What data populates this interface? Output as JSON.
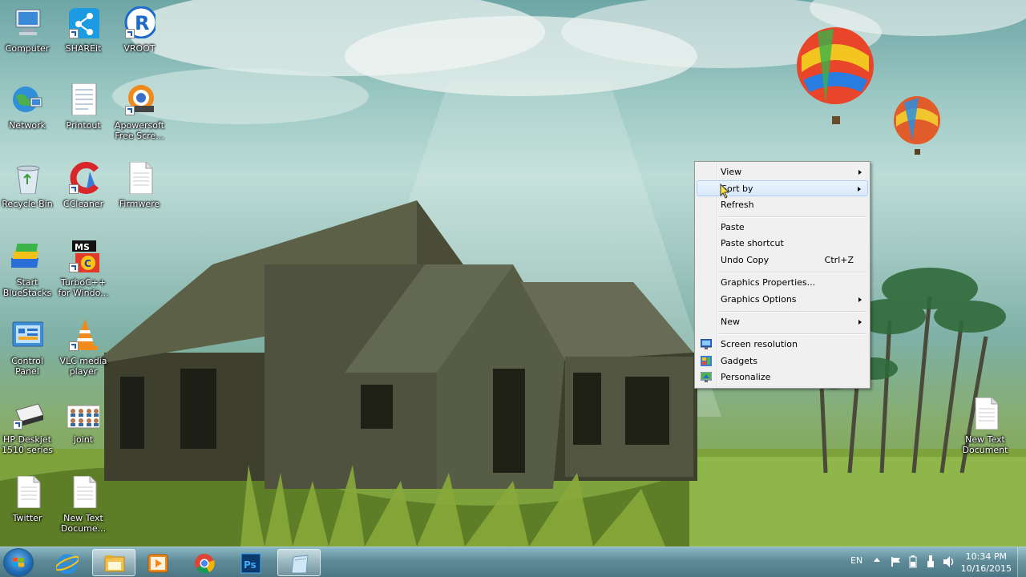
{
  "desktop_icons": [
    {
      "id": "computer",
      "label": "Computer"
    },
    {
      "id": "shareit",
      "label": "SHAREit"
    },
    {
      "id": "vroot",
      "label": "VROOT"
    },
    {
      "id": "network",
      "label": "Network"
    },
    {
      "id": "printout",
      "label": "Printout"
    },
    {
      "id": "apowersoft",
      "label": "Apowersoft\nFree Scre..."
    },
    {
      "id": "recycle-bin",
      "label": "Recycle Bin"
    },
    {
      "id": "ccleaner",
      "label": "CCleaner"
    },
    {
      "id": "firmwere",
      "label": "Firmwere"
    },
    {
      "id": "bluestacks",
      "label": "Start\nBlueStacks"
    },
    {
      "id": "turboc",
      "label": "TurboC++\nfor Windo..."
    },
    {
      "id": "control-panel",
      "label": "Control\nPanel"
    },
    {
      "id": "vlc",
      "label": "VLC media\nplayer"
    },
    {
      "id": "hp-deskjet",
      "label": "HP Deskjet\n1510 series"
    },
    {
      "id": "joint",
      "label": "joint"
    },
    {
      "id": "twitter",
      "label": "Twitter"
    },
    {
      "id": "new-text-document-left",
      "label": "New Text\nDocume..."
    },
    {
      "id": "new-text-document-right",
      "label": "New Text\nDocument"
    }
  ],
  "context_menu": {
    "items": [
      {
        "label": "View",
        "submenu": true
      },
      {
        "label": "Sort by",
        "submenu": true,
        "highlighted": true
      },
      {
        "label": "Refresh"
      },
      {
        "label": "Paste"
      },
      {
        "label": "Paste shortcut"
      },
      {
        "label": "Undo Copy",
        "shortcut": "Ctrl+Z"
      },
      {
        "label": "Graphics Properties..."
      },
      {
        "label": "Graphics Options",
        "submenu": true
      },
      {
        "label": "New",
        "submenu": true
      },
      {
        "label": "Screen resolution",
        "icon": "screen-resolution-icon"
      },
      {
        "label": "Gadgets",
        "icon": "gadgets-icon"
      },
      {
        "label": "Personalize",
        "icon": "personalize-icon"
      }
    ]
  },
  "taskbar": {
    "pinned": [
      "internet-explorer",
      "windows-explorer",
      "media-player",
      "google-chrome",
      "photoshop",
      "notepad"
    ],
    "tray": {
      "language": "EN",
      "time": "10:34 PM",
      "date": "10/16/2015"
    }
  },
  "colors": {
    "menu_bg": "#f0f0f0",
    "menu_highlight": "#d9e9fc",
    "taskbar": "#5f8b98"
  }
}
